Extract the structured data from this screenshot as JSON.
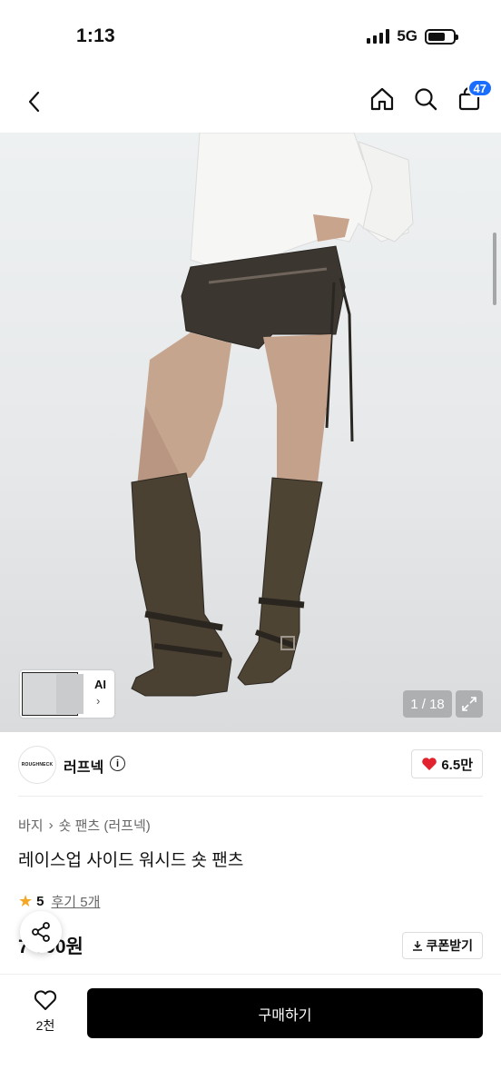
{
  "status_bar": {
    "time": "1:13",
    "network": "5G"
  },
  "nav": {
    "cart_count": "47"
  },
  "product_image": {
    "page_counter": "1 / 18",
    "thumbnail_label": "AI"
  },
  "brand": {
    "name": "러프넥",
    "logo_text": "ROUGHNECK",
    "likes": "6.5만"
  },
  "breadcrumb": {
    "category": "바지",
    "subcategory": "숏 팬츠 (러프넥)"
  },
  "product": {
    "title": "레이스업 사이드 워시드 숏 팬츠",
    "rating": "5",
    "review_label": "후기 5개",
    "price": "7 000원",
    "coupon_label": "쿠폰받기"
  },
  "bottom_bar": {
    "wish_count": "2천",
    "buy_label": "구매하기"
  },
  "colors": {
    "accent_blue": "#1a6dff",
    "like_red": "#e0232e",
    "star": "#f5a623",
    "buy_button": "#000000"
  }
}
